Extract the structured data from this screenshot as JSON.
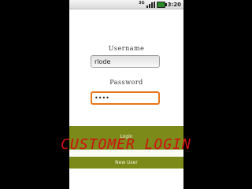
{
  "status_bar": {
    "signal_label": "3G",
    "time": "3:20",
    "icons": [
      "3g-signal-icon",
      "signal-bars-icon",
      "battery-icon"
    ]
  },
  "form": {
    "username_label": "Username",
    "username_value": "rlode",
    "password_label": "Password",
    "password_value": "••••"
  },
  "buttons": {
    "login_label": "Login",
    "new_user_label": "New User"
  },
  "overlay": {
    "title": "CUSTOMER LOGIN"
  },
  "colors": {
    "accent_olive": "#7c8a1a",
    "focus_orange": "#e8761a",
    "overlay_red": "#d01010"
  }
}
